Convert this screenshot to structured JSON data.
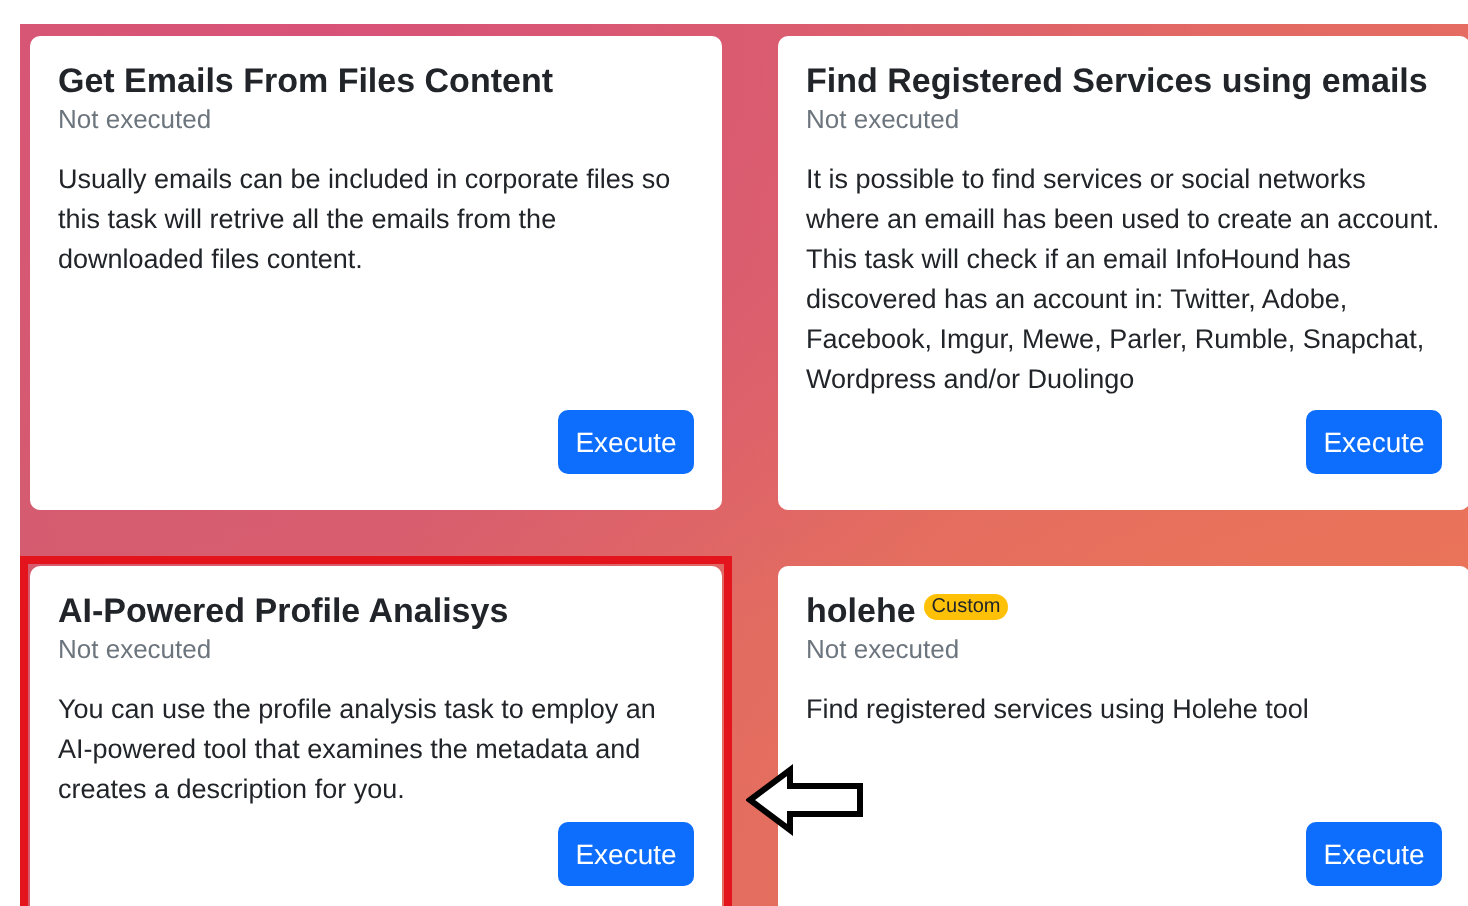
{
  "tasks": [
    {
      "title": "Get Emails From Files Content",
      "status": "Not executed",
      "description": "Usually emails can be included in corporate files so this task will retrive all the emails from the downloaded files content.",
      "button": "Execute",
      "highlighted": false
    },
    {
      "title": "Find Registered Services using emails",
      "status": "Not executed",
      "description": "It is possible to find services or social networks where an emaill has been used to create an account. This task will check if an email InfoHound has discovered has an account in: Twitter, Adobe, Facebook, Imgur, Mewe, Parler, Rumble, Snapchat, Wordpress and/or Duolingo",
      "button": "Execute",
      "highlighted": false
    },
    {
      "title": "AI-Powered Profile Analisys",
      "status": "Not executed",
      "description": "You can use the profile analysis task to employ an AI-powered tool that examines the metadata and creates a description for you.",
      "button": "Execute",
      "highlighted": true
    },
    {
      "title": "holehe",
      "badge": "Custom",
      "status": "Not executed",
      "description": "Find registered services using Holehe tool",
      "button": "Execute",
      "highlighted": false
    }
  ]
}
